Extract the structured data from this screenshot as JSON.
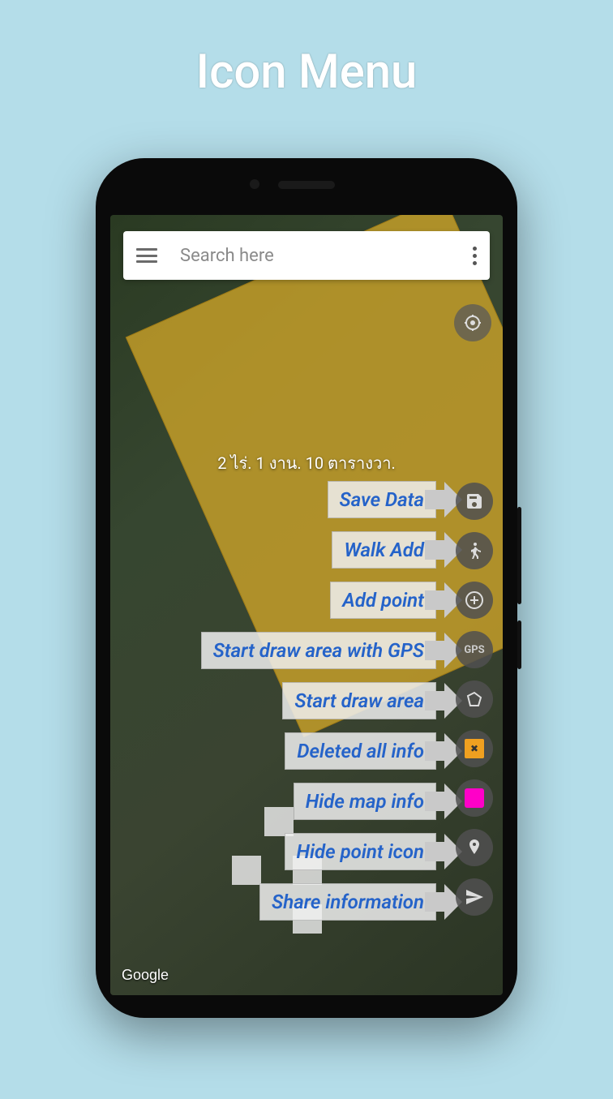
{
  "page_title": "Icon Menu",
  "search": {
    "placeholder": "Search here"
  },
  "area_measurement": "2 ไร่. 1 งาน. 10 ตารางวา.",
  "attribution": "Google",
  "menu_items": [
    {
      "label": "Save Data",
      "icon": "save-icon"
    },
    {
      "label": "Walk Add",
      "icon": "walk-icon"
    },
    {
      "label": "Add point",
      "icon": "plus-icon"
    },
    {
      "label": "Start draw area with GPS",
      "icon": "gps-icon"
    },
    {
      "label": "Start draw area",
      "icon": "polygon-icon"
    },
    {
      "label": "Deleted all info",
      "icon": "delete-icon"
    },
    {
      "label": "Hide map info",
      "icon": "layers-icon"
    },
    {
      "label": "Hide point icon",
      "icon": "pin-icon"
    },
    {
      "label": "Share information",
      "icon": "send-icon"
    }
  ]
}
